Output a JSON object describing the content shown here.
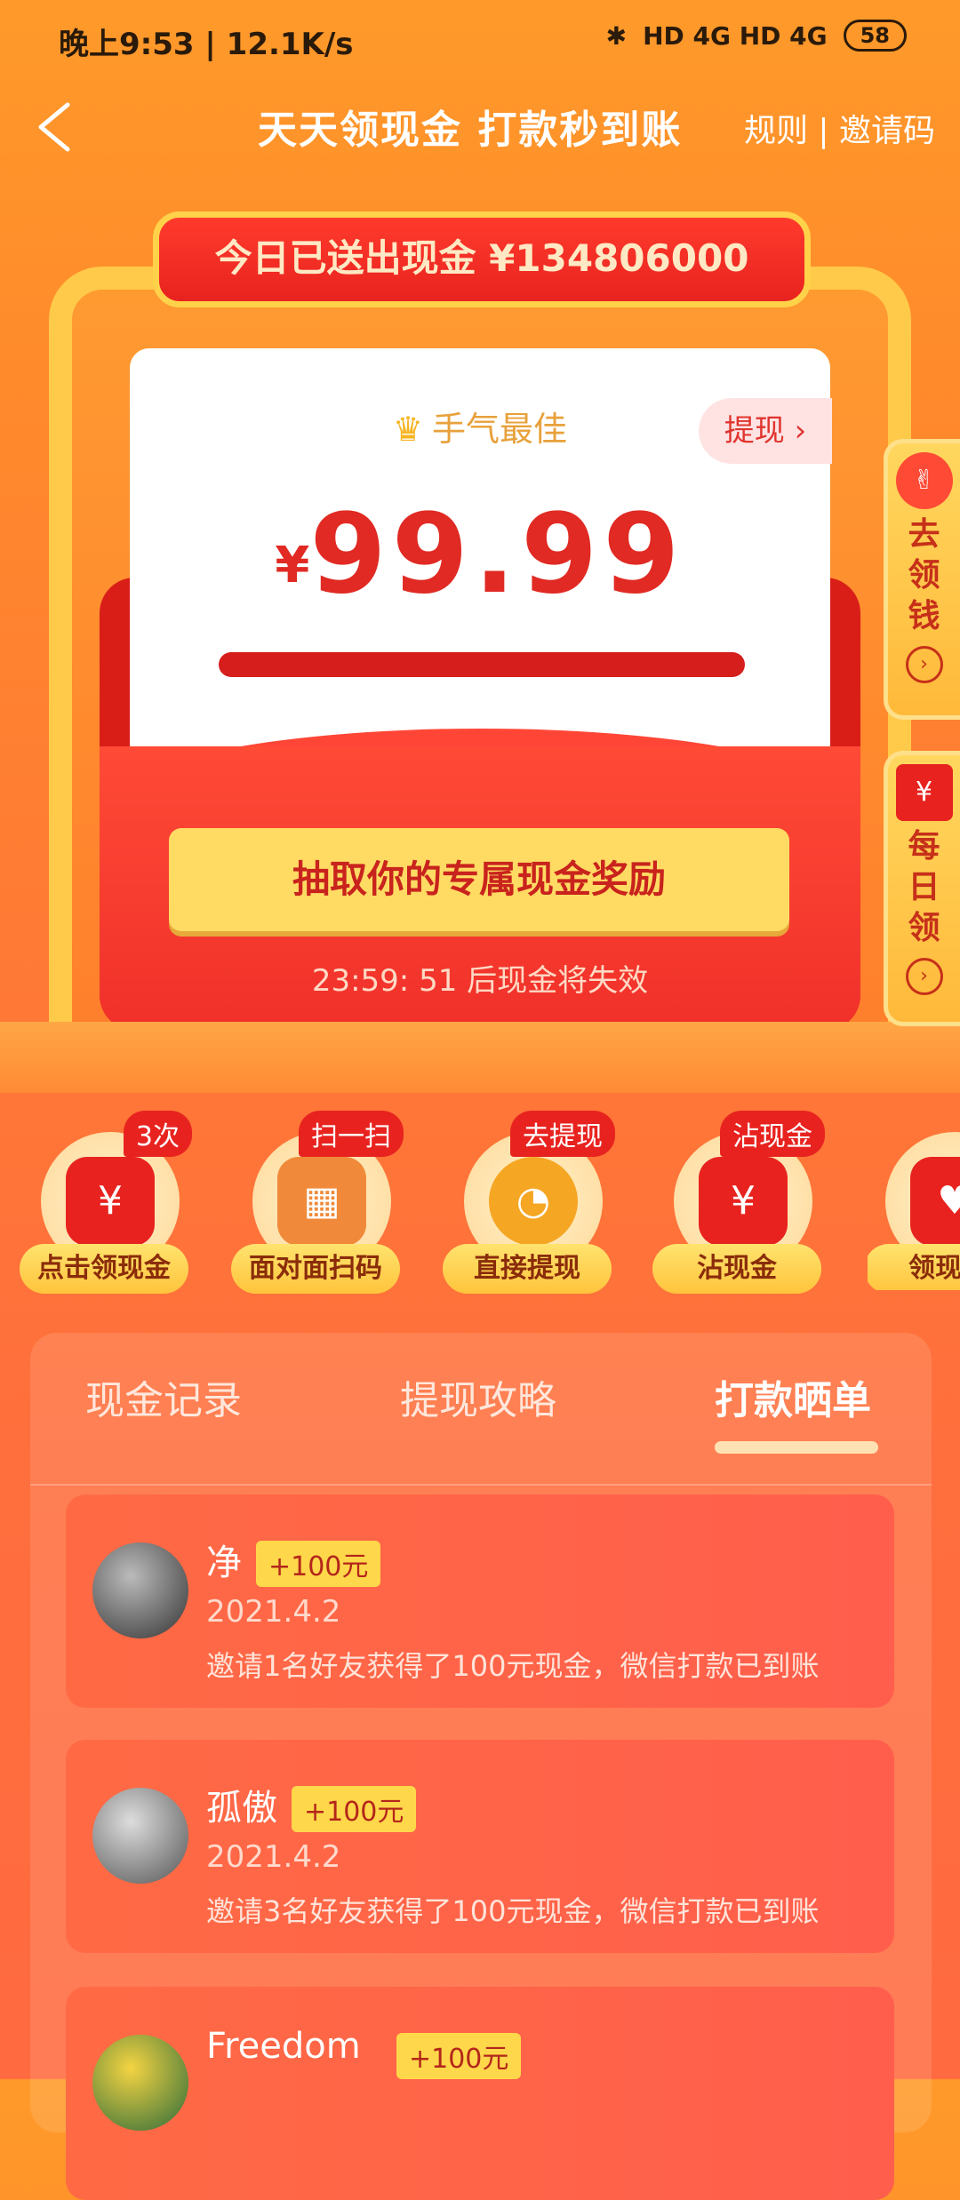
{
  "status_bar": {
    "time": "晚上9:53 | 12.1K/s",
    "network": "HD 4G HD 4G",
    "battery": "58"
  },
  "header": {
    "title": "天天领现金 打款秒到账",
    "links": "规则 | 邀请码"
  },
  "banner": {
    "text": "今日已送出现金 ¥134806000"
  },
  "card": {
    "best_label": "手气最佳",
    "withdraw_label": "提现",
    "currency": "¥",
    "amount": "99.99"
  },
  "cta": {
    "label": "抽取你的专属现金奖励"
  },
  "timer": {
    "text": "23:59: 51 后现金将失效"
  },
  "side_tabs": [
    {
      "label": "去领钱"
    },
    {
      "label": "每日领"
    }
  ],
  "quick_actions": [
    {
      "badge": "3次",
      "label": "点击领现金",
      "icon": "¥"
    },
    {
      "badge": "扫一扫",
      "label": "面对面扫码",
      "icon": "▦"
    },
    {
      "badge": "去提现",
      "label": "直接提现",
      "icon": "◔"
    },
    {
      "badge": "沾现金",
      "label": "沾现金",
      "icon": "¥"
    },
    {
      "badge": "",
      "label": "领现金",
      "icon": "♥"
    }
  ],
  "tabs": [
    {
      "label": "现金记录"
    },
    {
      "label": "提现攻略"
    },
    {
      "label": "打款晒单"
    }
  ],
  "records": [
    {
      "name": "净",
      "tag": "+100元",
      "date": "2021.4.2",
      "desc": "邀请1名好友获得了100元现金，微信打款已到账"
    },
    {
      "name": "孤傲",
      "tag": "+100元",
      "date": "2021.4.2",
      "desc": "邀请3名好友获得了100元现金，微信打款已到账"
    },
    {
      "name": "Freedom",
      "tag": "+100元",
      "date": "",
      "desc": ""
    }
  ],
  "colors": {
    "accent_red": "#e02a23",
    "gold": "#ffd74a",
    "bg_orange": "#ff8a2b"
  }
}
